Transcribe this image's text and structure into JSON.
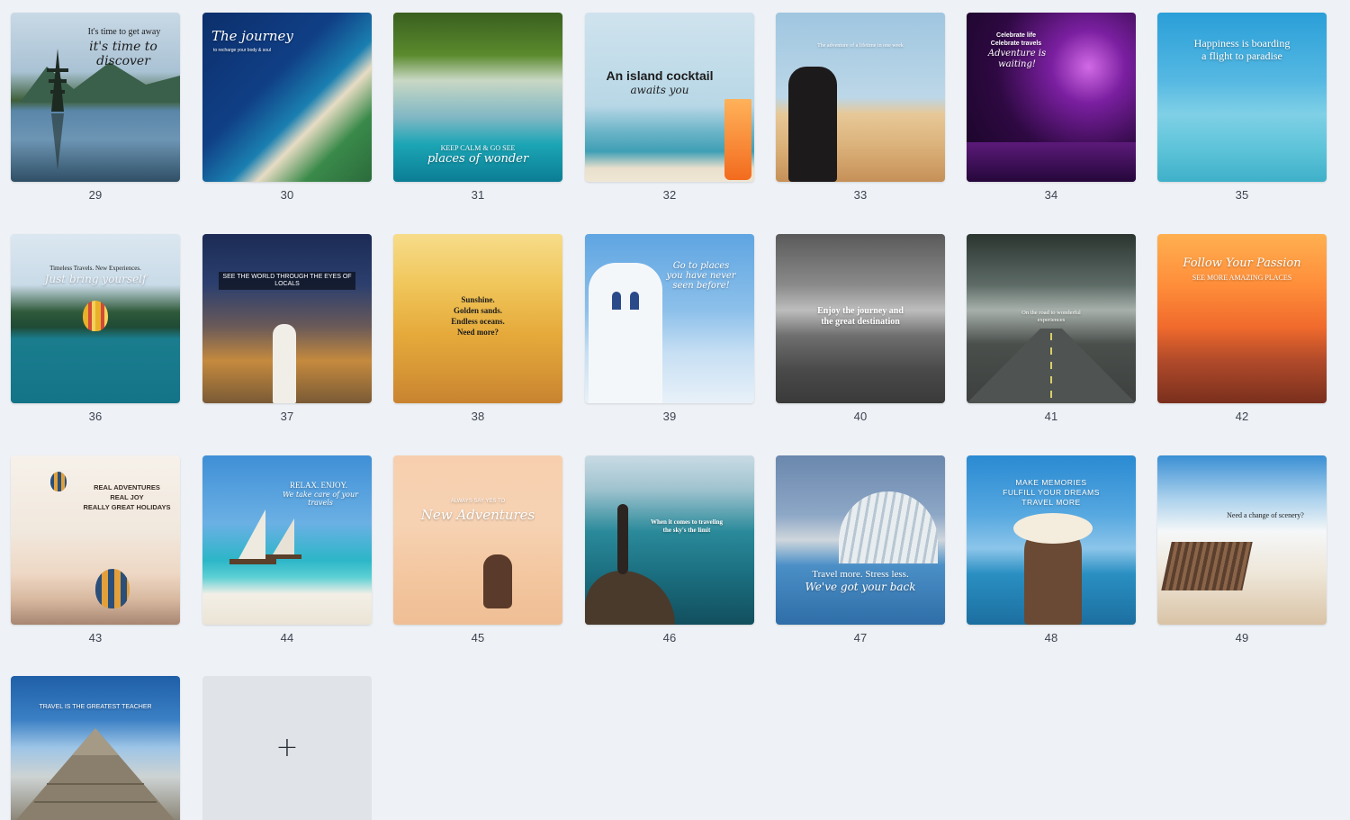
{
  "pages": [
    {
      "num": "29",
      "lines": [
        "It's time to get away",
        "it's time to discover"
      ]
    },
    {
      "num": "30",
      "lines": [
        "The journey",
        "to recharge your body & soul"
      ]
    },
    {
      "num": "31",
      "lines": [
        "KEEP CALM & GO SEE",
        "places of wonder"
      ]
    },
    {
      "num": "32",
      "lines": [
        "An island cocktail",
        "awaits you"
      ]
    },
    {
      "num": "33",
      "lines": [
        "The adventure of a lifetime in one week"
      ]
    },
    {
      "num": "34",
      "lines": [
        "Celebrate life",
        "Celebrate travels",
        "Adventure is waiting!"
      ]
    },
    {
      "num": "35",
      "lines": [
        "Happiness is boarding",
        "a flight to paradise"
      ]
    },
    {
      "num": "36",
      "lines": [
        "Timeless Travels. New Experiences.",
        "Just bring yourself"
      ]
    },
    {
      "num": "37",
      "lines": [
        "SEE THE WORLD THROUGH THE EYES OF LOCALS"
      ]
    },
    {
      "num": "38",
      "lines": [
        "Sunshine.",
        "Golden sands.",
        "Endless oceans.",
        "Need more?"
      ]
    },
    {
      "num": "39",
      "lines": [
        "Go to places",
        "you have never",
        "seen before!"
      ]
    },
    {
      "num": "40",
      "lines": [
        "Enjoy the journey and",
        "the great destination"
      ]
    },
    {
      "num": "41",
      "lines": [
        "On the road to wonderful",
        "experiences"
      ]
    },
    {
      "num": "42",
      "lines": [
        "Follow Your Passion",
        "SEE MORE AMAZING PLACES"
      ]
    },
    {
      "num": "43",
      "lines": [
        "REAL ADVENTURES",
        "REAL JOY",
        "REALLY GREAT HOLIDAYS"
      ]
    },
    {
      "num": "44",
      "lines": [
        "RELAX. ENJOY.",
        "We take care of your travels"
      ]
    },
    {
      "num": "45",
      "lines": [
        "ALWAYS SAY YES TO",
        "New Adventures"
      ]
    },
    {
      "num": "46",
      "lines": [
        "When it comes to traveling",
        "the sky's the limit"
      ]
    },
    {
      "num": "47",
      "lines": [
        "Travel more. Stress less.",
        "We've got your back"
      ]
    },
    {
      "num": "48",
      "lines": [
        "MAKE MEMORIES",
        "FULFILL YOUR DREAMS",
        "TRAVEL MORE"
      ]
    },
    {
      "num": "49",
      "lines": [
        "Need a change of scenery?"
      ]
    },
    {
      "num": "50",
      "lines": [
        "TRAVEL IS THE GREATEST TEACHER"
      ]
    }
  ],
  "add_page": {
    "icon": "plus-icon",
    "symbol": "+"
  }
}
